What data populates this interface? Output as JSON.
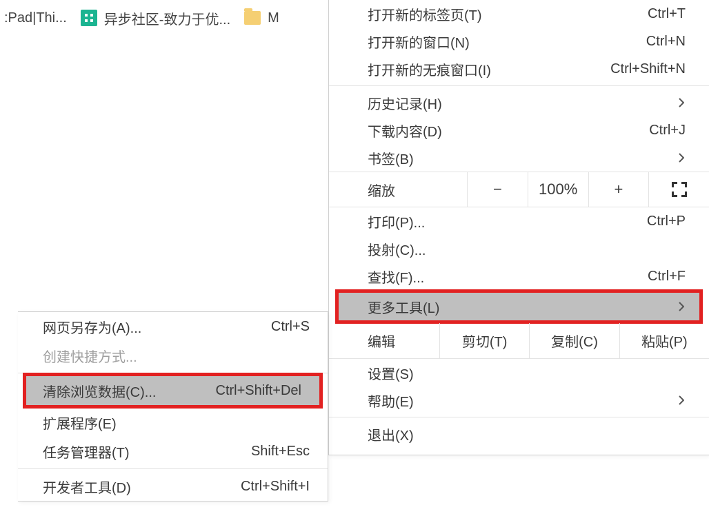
{
  "bookmarks": {
    "item0": ":Pad|Thi...",
    "item1": "异步社区-致力于优...",
    "item2": "M"
  },
  "main_menu": {
    "new_tab": {
      "label": "打开新的标签页(T)",
      "shortcut": "Ctrl+T"
    },
    "new_window": {
      "label": "打开新的窗口(N)",
      "shortcut": "Ctrl+N"
    },
    "new_incognito": {
      "label": "打开新的无痕窗口(I)",
      "shortcut": "Ctrl+Shift+N"
    },
    "history": {
      "label": "历史记录(H)"
    },
    "downloads": {
      "label": "下载内容(D)",
      "shortcut": "Ctrl+J"
    },
    "bookmarks": {
      "label": "书签(B)"
    },
    "zoom": {
      "label": "缩放",
      "value": "100%",
      "minus": "−",
      "plus": "+"
    },
    "print": {
      "label": "打印(P)...",
      "shortcut": "Ctrl+P"
    },
    "cast": {
      "label": "投射(C)..."
    },
    "find": {
      "label": "查找(F)...",
      "shortcut": "Ctrl+F"
    },
    "more_tools": {
      "label": "更多工具(L)"
    },
    "edit": {
      "label": "编辑",
      "cut": "剪切(T)",
      "copy": "复制(C)",
      "paste": "粘贴(P)"
    },
    "settings": {
      "label": "设置(S)"
    },
    "help": {
      "label": "帮助(E)"
    },
    "exit": {
      "label": "退出(X)"
    }
  },
  "sub_menu": {
    "save_as": {
      "label": "网页另存为(A)...",
      "shortcut": "Ctrl+S"
    },
    "create_shortcut": {
      "label": "创建快捷方式..."
    },
    "clear_data": {
      "label": "清除浏览数据(C)...",
      "shortcut": "Ctrl+Shift+Del"
    },
    "extensions": {
      "label": "扩展程序(E)"
    },
    "task_manager": {
      "label": "任务管理器(T)",
      "shortcut": "Shift+Esc"
    },
    "dev_tools": {
      "label": "开发者工具(D)",
      "shortcut": "Ctrl+Shift+I"
    }
  }
}
